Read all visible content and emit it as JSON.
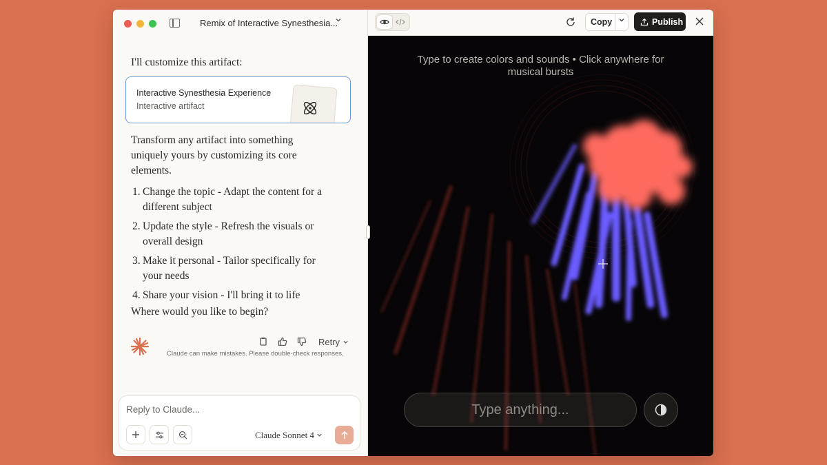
{
  "titlebar": {
    "conversation_title": "Remix of Interactive Synesthesia..."
  },
  "chat": {
    "intro": "I'll customize this artifact:",
    "artifact": {
      "title": "Interactive Synesthesia Experience",
      "subtitle": "Interactive artifact",
      "icon": "atom-icon"
    },
    "paragraph": "Transform any artifact into something uniquely yours by customizing its core elements.",
    "steps": [
      {
        "num": "1.",
        "text": "Change the topic - Adapt the content for a different subject"
      },
      {
        "num": "2.",
        "text": "Update the style - Refresh the visuals or overall design"
      },
      {
        "num": "3.",
        "text": "Make it personal - Tailor specifically for your needs"
      },
      {
        "num": "4.",
        "text": "Share your vision - I'll bring it to life"
      }
    ],
    "closing": "Where would you like to begin?",
    "retry_label": "Retry",
    "disclaimer": "Claude can make mistakes. Please double-check responses."
  },
  "composer": {
    "placeholder": "Reply to Claude...",
    "model": "Claude Sonnet 4"
  },
  "artifact_panel": {
    "copy_label": "Copy",
    "publish_label": "Publish",
    "hint": "Type to create colors and sounds • Click anywhere for musical bursts",
    "input_placeholder": "Type anything..."
  },
  "colors": {
    "accent": "#d9704f",
    "send": "#e8ab96",
    "blob_red": "#ff6b5f",
    "blob_blue": "#6a5cff"
  }
}
